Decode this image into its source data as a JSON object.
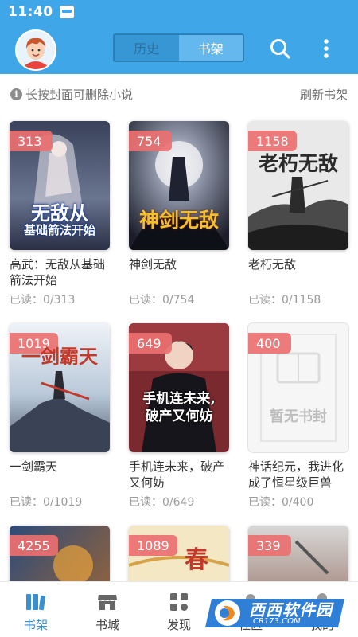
{
  "status_bar": {
    "time": "11:40"
  },
  "header": {
    "tabs": [
      {
        "label": "历史",
        "active": false
      },
      {
        "label": "书架",
        "active": true
      }
    ],
    "icons": [
      "avatar",
      "search-icon",
      "more-vertical-icon"
    ]
  },
  "info_bar": {
    "hint": "长按封面可删除小说",
    "refresh": "刷新书架"
  },
  "books": [
    {
      "badge": "313",
      "title": "高武：无敌从基础箭法开始",
      "progress": "已读：0/313",
      "cover_text": [
        "无敌从",
        "基础箭法开始"
      ]
    },
    {
      "badge": "754",
      "title": "神剑无敌",
      "progress": "已读：0/754",
      "cover_text": [
        "神剑无敌"
      ]
    },
    {
      "badge": "1158",
      "title": "老朽无敌",
      "progress": "已读：0/1158",
      "cover_text": [
        "老朽无敌"
      ]
    },
    {
      "badge": "1019",
      "title": "一剑霸天",
      "progress": "已读：0/1019",
      "cover_text": [
        "一剑霸天"
      ]
    },
    {
      "badge": "649",
      "title": "手机连未来，破产又何妨",
      "progress": "已读：0/649",
      "cover_text": [
        "手机连未来,",
        "破产又何妨"
      ]
    },
    {
      "badge": "400",
      "title": "神话纪元，我进化成了恒星级巨兽",
      "progress": "已读：0/400",
      "cover_text": [
        "暂无书封"
      ]
    },
    {
      "badge": "4255"
    },
    {
      "badge": "1089",
      "cover_text": [
        "春"
      ]
    },
    {
      "badge": "339"
    }
  ],
  "bottom_nav": {
    "items": [
      {
        "label": "书架",
        "icon": "bookshelf-icon",
        "active": true
      },
      {
        "label": "书城",
        "icon": "store-icon",
        "active": false
      },
      {
        "label": "发现",
        "icon": "discover-icon",
        "active": false
      },
      {
        "label": "社区",
        "icon": "community-icon",
        "active": false
      },
      {
        "label": "我的",
        "icon": "profile-icon",
        "active": false
      }
    ]
  },
  "watermark": {
    "text": "西西软件园",
    "sub": "CR173.COM"
  },
  "colors": {
    "primary": "#3fa6e8",
    "badge": "#ec7070",
    "active_tab": "#64b8ee"
  }
}
